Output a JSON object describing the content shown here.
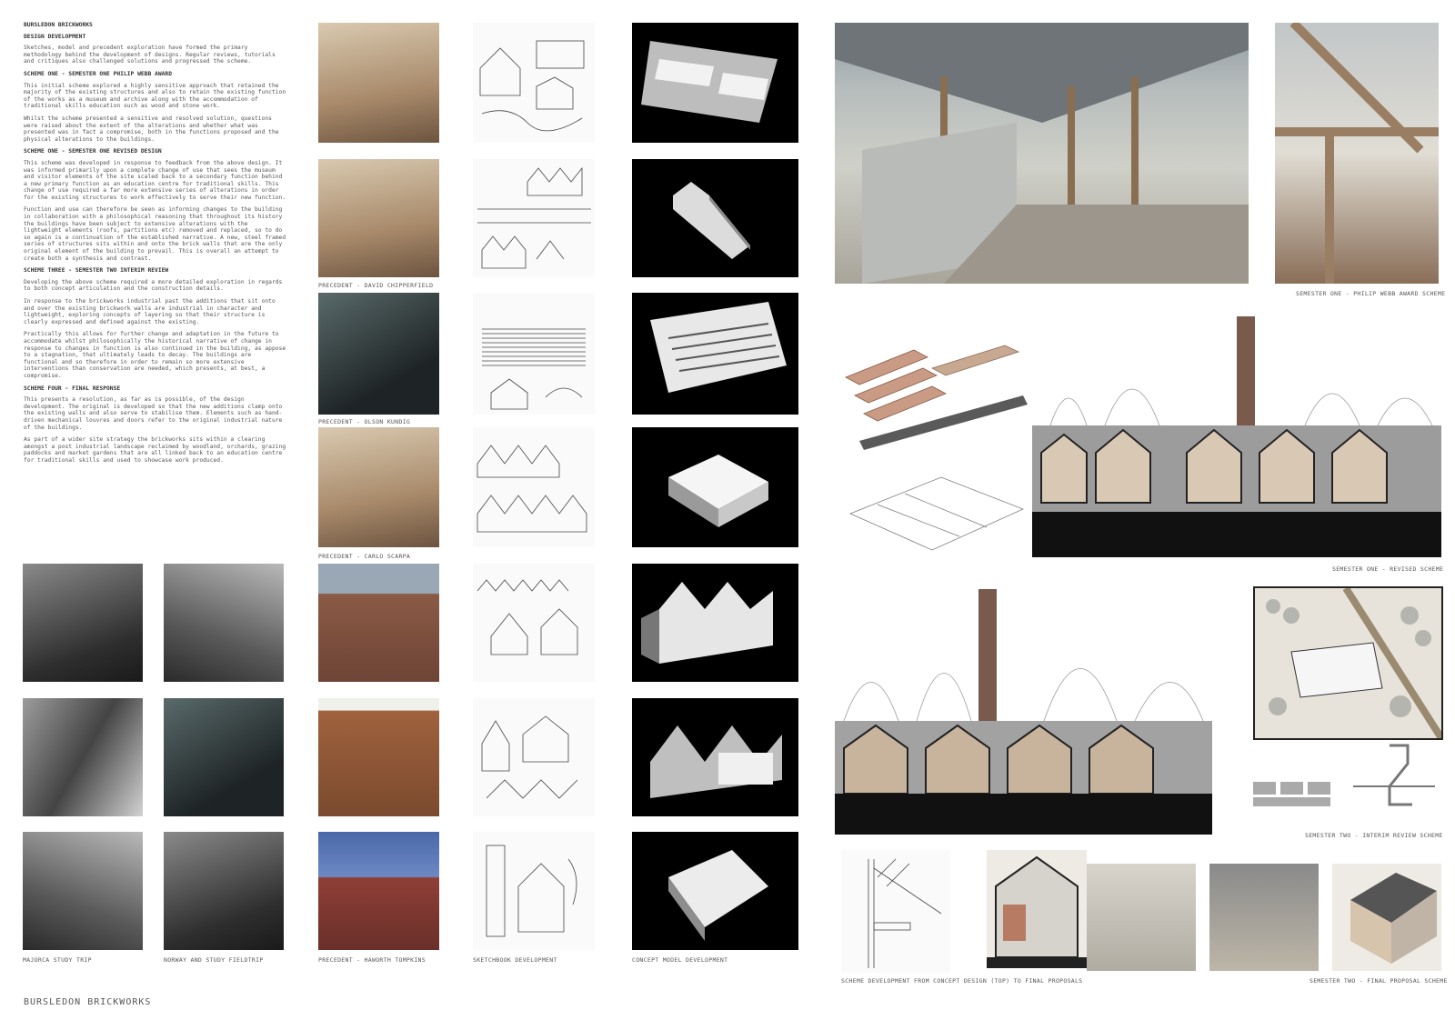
{
  "intro": {
    "title": "BURSLEDON BRICKWORKS",
    "sections": [
      {
        "heading": "DESIGN DEVELOPMENT",
        "paragraphs": [
          "Sketches, model and precedent exploration have formed the primary methodology behind the development of designs. Regular reviews, tutorials and critiques also challenged solutions and progressed the scheme."
        ]
      },
      {
        "heading": "SCHEME ONE - SEMESTER ONE PHILIP WEBB AWARD",
        "paragraphs": [
          "This initial scheme explored a highly sensitive approach that retained the majority of the existing structures and also to retain the existing function of the works as a museum and archive along with the accommodation of traditional skills education such as wood and stone work.",
          "Whilst the scheme presented a sensitive and resolved solution, questions were raised about the extent of the alterations and whether what was presented was in fact a compromise, both in the functions proposed and the physical alterations to the buildings."
        ]
      },
      {
        "heading": "SCHEME ONE - SEMESTER ONE REVISED DESIGN",
        "paragraphs": [
          "This scheme was developed in response to feedback from the above design. It was informed primarily upon a complete change of use that sees the museum and visitor elements of the site scaled back to a secondary function behind a new primary function as an education centre for traditional skills. This change of use required a far more extensive series of alterations in order for the existing structures to work effectively to serve their new function.",
          "Function and use can therefore be seen as informing changes to the building in collaboration with a philosophical reasoning that throughout its history the buildings have been subject to extensive alterations with the lightweight elements (roofs, partitions etc) removed and replaced, so to do so again is a continuation of the established narrative. A new, steel framed series of structures sits within and onto the brick walls that are the only original element of the building to prevail. This is overall an attempt to create both a synthesis and contrast."
        ]
      },
      {
        "heading": "SCHEME THREE - SEMESTER TWO INTERIM REVIEW",
        "paragraphs": [
          "Developing the above scheme required a more detailed exploration in regards to both concept articulation and the construction details.",
          "In response to the brickworks industrial past the additions that sit onto and over the existing brickwork walls are industrial in character and lightweight, exploring concepts of layering so that their structure is clearly expressed and defined against the existing.",
          "Practically this allows for further change and adaptation in the future to accommodate whilst philosophically the historical narrative of change in response to changes in function is also continued in the building, as appose to a stagnation, that ultimately leads to decay. The buildings are functional and so therefore in order to remain so more extensive interventions than conservation are needed, which presents, at best, a compromise."
        ]
      },
      {
        "heading": "SCHEME FOUR - FINAL RESPONSE",
        "paragraphs": [
          "This presents a resolution, as far as is possible, of the design development. The original is developed so that the new additions clamp onto the existing walls and also serve to stabilise them. Elements such as hand-driven mechanical louvres and doors refer to the original industrial nature of the buildings.",
          "As part of a wider site strategy the brickworks sits within a clearing amongst a post industrial landscape reclaimed by woodland, orchards, grazing paddocks and market gardens that are all linked back to an education centre for traditional skills and used to showcase work produced."
        ]
      }
    ]
  },
  "captions": {
    "majorca": "MAJORCA STUDY TRIP",
    "norway": "NORWAY AND STUDY FIELDTRIP",
    "chipperfield": "PRECEDENT - DAVID CHIPPERFIELD",
    "olson": "PRECEDENT - OLSON KUNDIG",
    "scarpa": "PRECEDENT - CARLO SCARPA",
    "haworth": "PRECEDENT - HAWORTH TOMPKINS",
    "sketchbook": "SKETCHBOOK DEVELOPMENT",
    "concept_model": "CONCEPT MODEL DEVELOPMENT",
    "webb": "SEMESTER ONE - PHILIP WEBB AWARD SCHEME",
    "revised": "SEMESTER ONE - REVISED SCHEME",
    "interim": "SEMESTER TWO - INTERIM REVIEW SCHEME",
    "scheme_dev": "SCHEME DEVELOPMENT FROM CONCEPT DESIGN (TOP) TO FINAL PROPOSALS",
    "final": "SEMESTER TWO - FINAL PROPOSAL SCHEME"
  },
  "footer": "BURSLEDON BRICKWORKS"
}
